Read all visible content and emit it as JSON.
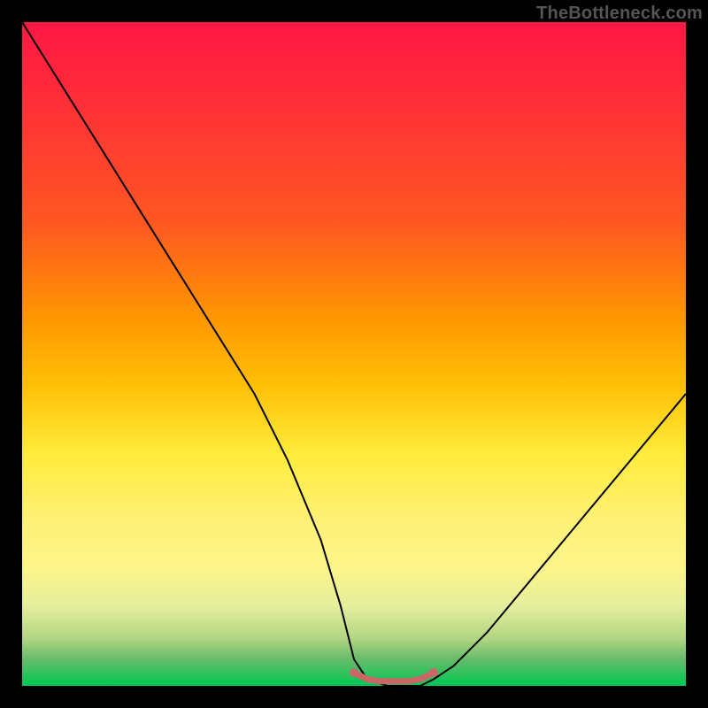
{
  "watermark": "TheBottleneck.com",
  "chart_data": {
    "type": "line",
    "title": "",
    "xlabel": "",
    "ylabel": "",
    "xlim": [
      0,
      100
    ],
    "ylim": [
      0,
      100
    ],
    "background_gradient": {
      "direction": "top-to-bottom",
      "stops": [
        {
          "pos": 0,
          "color": "#ff1744"
        },
        {
          "pos": 30,
          "color": "#ff5722"
        },
        {
          "pos": 55,
          "color": "#ffc107"
        },
        {
          "pos": 75,
          "color": "#fff176"
        },
        {
          "pos": 100,
          "color": "#00c853"
        }
      ]
    },
    "series": [
      {
        "name": "bottleneck-curve",
        "x": [
          0,
          5,
          10,
          15,
          20,
          25,
          30,
          35,
          40,
          45,
          48,
          50,
          52,
          55,
          57,
          60,
          62,
          65,
          70,
          75,
          80,
          85,
          90,
          95,
          100
        ],
        "y": [
          100,
          92,
          84,
          76,
          68,
          60,
          52,
          44,
          34,
          22,
          12,
          4,
          1,
          0,
          0,
          0,
          1,
          3,
          8,
          14,
          20,
          26,
          32,
          38,
          44
        ],
        "color": "#000000",
        "width": 2
      },
      {
        "name": "optimal-flat",
        "x": [
          50,
          52,
          54,
          56,
          58,
          60,
          62
        ],
        "y": [
          2,
          1,
          0.7,
          0.7,
          0.7,
          1,
          2
        ],
        "color": "#cc6666",
        "width": 7,
        "endpoints_marker": true
      }
    ]
  }
}
